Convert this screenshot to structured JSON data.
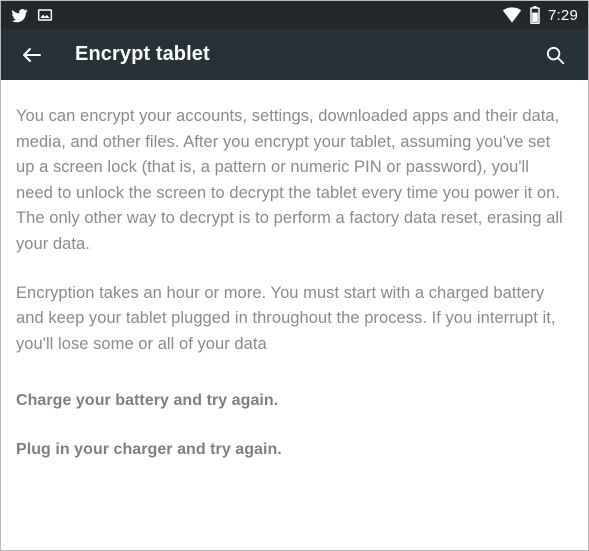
{
  "status_bar": {
    "icons": [
      {
        "name": "twitter-icon",
        "label": "Twitter"
      },
      {
        "name": "photo-icon",
        "label": "Screenshot captured"
      }
    ],
    "wifi": "wifi-icon",
    "battery": "battery-icon",
    "time": "7:29"
  },
  "action_bar": {
    "back": "back-arrow-icon",
    "title": "Encrypt tablet",
    "search": "search-icon"
  },
  "content": {
    "paragraph_1": "You can encrypt your accounts, settings, downloaded apps and their data, media, and other files. After you encrypt your tablet, assuming you've set up a screen lock (that is, a pattern or numeric PIN or password), you'll need to unlock the screen to decrypt the tablet every time you power it on. The only other way to decrypt is to perform a factory data reset, erasing all your data.",
    "paragraph_2": "Encryption takes an hour or more. You must start with a charged battery and keep your tablet plugged in throughout the process. If you interrupt it, you'll lose some or all of your data",
    "warning_1": "Charge your battery and try again.",
    "warning_2": "Plug in your charger and try again."
  },
  "colors": {
    "status_bar_bg": "#22282b",
    "action_bar_bg": "#263238",
    "body_bg": "#ffffff",
    "body_text": "#8b8b8b",
    "warning_text": "#7f7f7f",
    "title_text": "#ffffff"
  }
}
